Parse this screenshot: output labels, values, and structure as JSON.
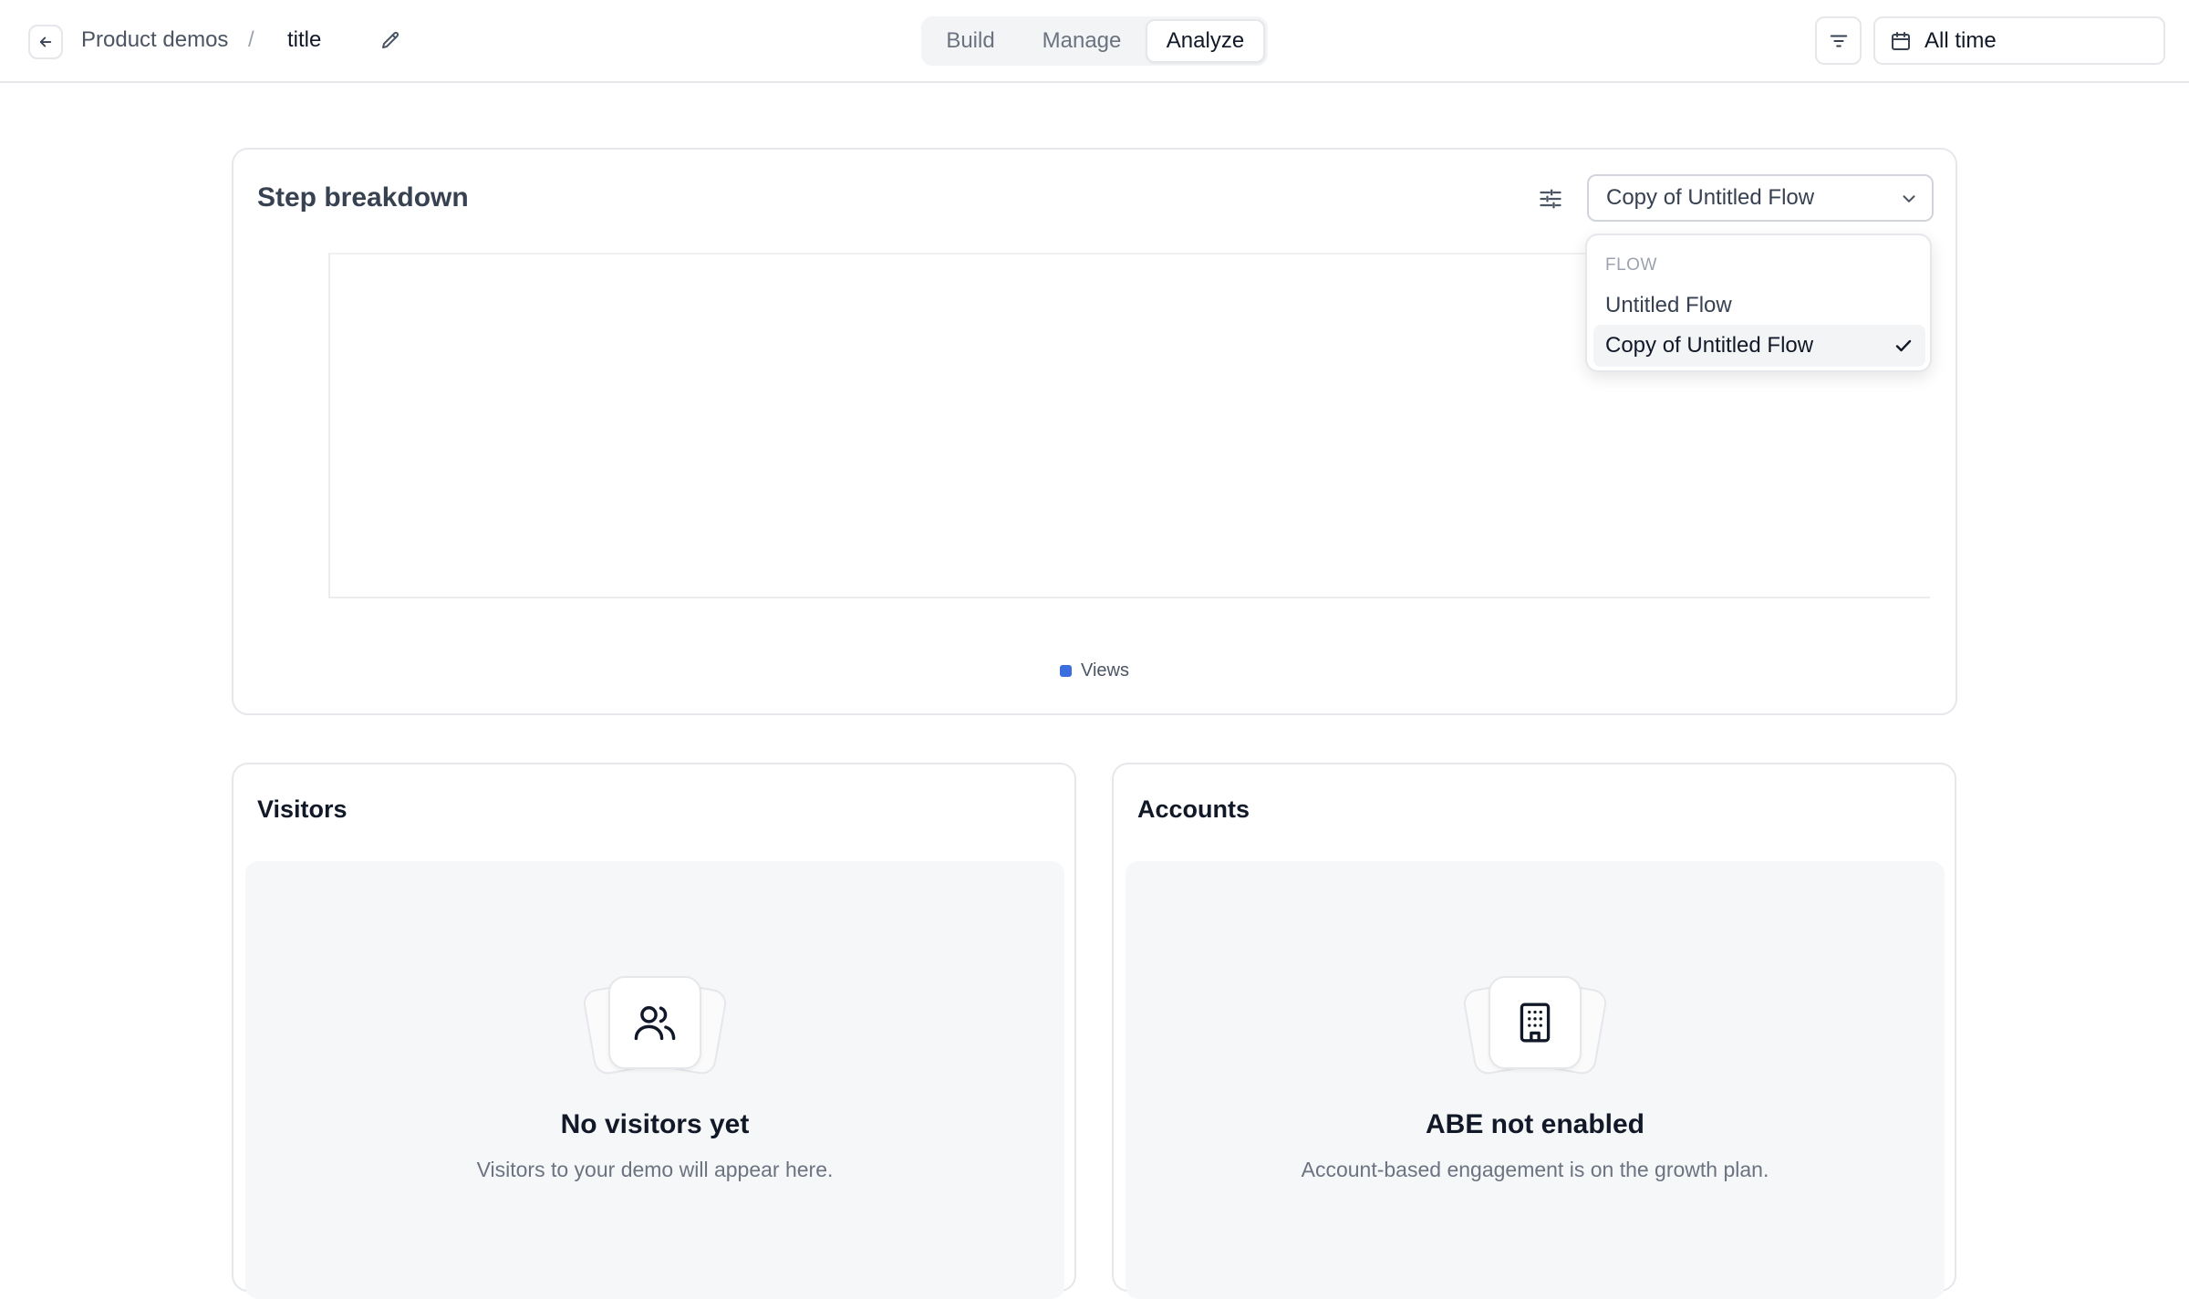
{
  "header": {
    "breadcrumb_parent": "Product demos",
    "breadcrumb_separator": "/",
    "breadcrumb_current": "title",
    "tabs": [
      {
        "label": "Build",
        "active": false
      },
      {
        "label": "Manage",
        "active": false
      },
      {
        "label": "Analyze",
        "active": true
      }
    ],
    "date_range": "All time",
    "icons": {
      "back": "arrow-left-icon",
      "edit": "pencil-icon",
      "filter": "filter-lines-icon",
      "calendar": "calendar-icon"
    }
  },
  "step_breakdown": {
    "title": "Step breakdown",
    "selected_flow": "Copy of Untitled Flow",
    "legend_label": "Views",
    "legend_color": "#3b6fe0",
    "dropdown": {
      "group_label": "FLOW",
      "options": [
        {
          "label": "Untitled Flow",
          "selected": false
        },
        {
          "label": "Copy of Untitled Flow",
          "selected": true
        }
      ]
    }
  },
  "visitors": {
    "title": "Visitors",
    "empty_title": "No visitors yet",
    "empty_subtitle": "Visitors to your demo will appear here.",
    "icon": "users-icon"
  },
  "accounts": {
    "title": "Accounts",
    "empty_title": "ABE not enabled",
    "empty_subtitle": "Account-based engagement is on the growth plan.",
    "icon": "building-icon"
  }
}
